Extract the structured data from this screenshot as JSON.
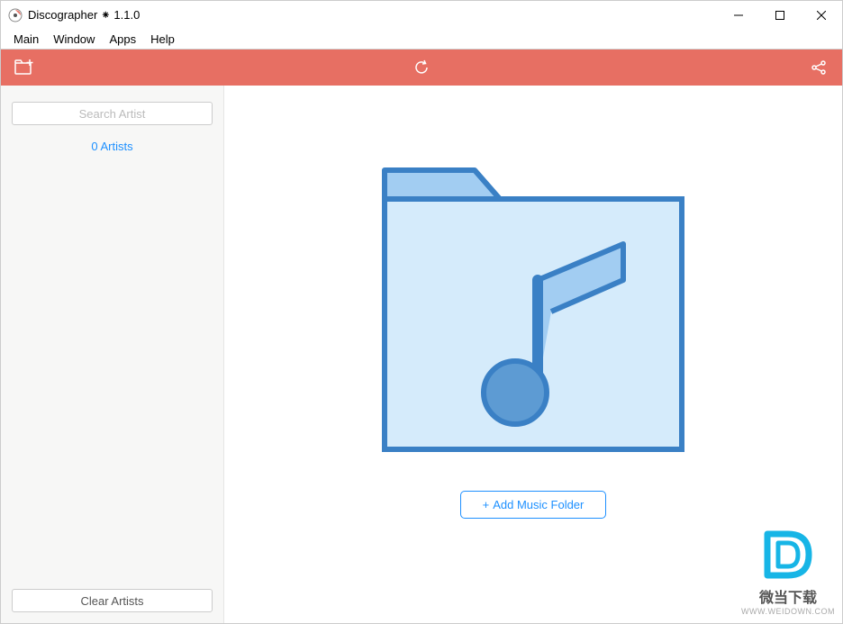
{
  "titlebar": {
    "title": "Discographer ⁕ 1.1.0"
  },
  "menubar": {
    "items": [
      "Main",
      "Window",
      "Apps",
      "Help"
    ]
  },
  "toolbar": {
    "add_icon": "add-folder",
    "refresh_icon": "refresh",
    "share_icon": "share"
  },
  "sidebar": {
    "search_placeholder": "Search Artist",
    "artist_count_label": "0 Artists",
    "clear_button_label": "Clear Artists"
  },
  "main": {
    "add_folder_label": "Add Music Folder"
  },
  "watermark": {
    "line1": "微当下载",
    "line2": "WWW.WEIDOWN.COM"
  }
}
